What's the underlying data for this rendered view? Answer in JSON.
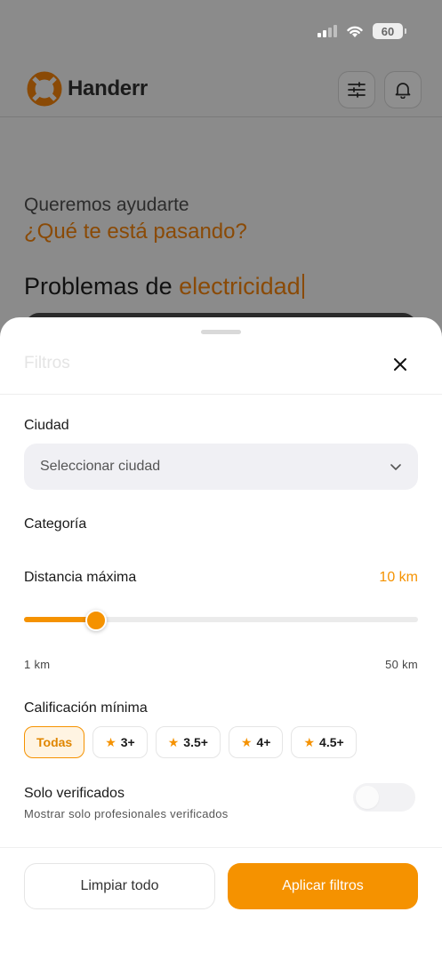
{
  "status_bar": {
    "battery": "60"
  },
  "app": {
    "name": "Handerr",
    "hero_subtitle": "Queremos ayudarte",
    "hero_question": "¿Qué te está pasando?",
    "hero_title_prefix": "Problemas de ",
    "hero_title_accent": "electricidad"
  },
  "filters": {
    "title": "Filtros",
    "city": {
      "label": "Ciudad",
      "placeholder": "Seleccionar ciudad"
    },
    "category": {
      "label": "Categoría"
    },
    "distance": {
      "label": "Distancia máxima",
      "value_text": "10 km",
      "value": 10,
      "min": 1,
      "max": 50,
      "min_label": "1 km",
      "max_label": "50 km"
    },
    "rating": {
      "label": "Calificación mínima",
      "options": [
        {
          "label": "Todas",
          "star": false,
          "selected": true
        },
        {
          "label": "3+",
          "star": true,
          "selected": false
        },
        {
          "label": "3.5+",
          "star": true,
          "selected": false
        },
        {
          "label": "4+",
          "star": true,
          "selected": false
        },
        {
          "label": "4.5+",
          "star": true,
          "selected": false
        }
      ]
    },
    "verified": {
      "label": "Solo verificados",
      "description": "Mostrar solo profesionales verificados",
      "enabled": false
    },
    "buttons": {
      "clear": "Limpiar todo",
      "apply": "Aplicar filtros"
    }
  },
  "colors": {
    "accent": "#F59200",
    "accent_dim": "#8A4A06",
    "overlay": "#8B8B8B"
  }
}
